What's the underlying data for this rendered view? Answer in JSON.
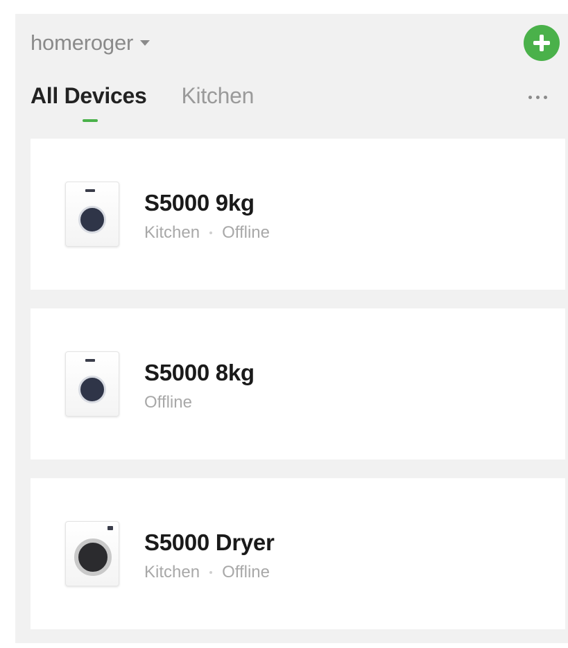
{
  "header": {
    "home_name": "homeroger"
  },
  "tabs": [
    {
      "label": "All Devices"
    },
    {
      "label": "Kitchen"
    }
  ],
  "devices": [
    {
      "name": "S5000 9kg",
      "room": "Kitchen",
      "status": "Offline",
      "icon": "washer-icon"
    },
    {
      "name": "S5000 8kg",
      "status": "Offline",
      "icon": "washer-icon"
    },
    {
      "name": "S5000 Dryer",
      "room": "Kitchen",
      "status": "Offline",
      "icon": "dryer-icon"
    }
  ],
  "colors": {
    "accent": "#4ab14a",
    "background": "#f1f1f1",
    "card": "#ffffff"
  }
}
